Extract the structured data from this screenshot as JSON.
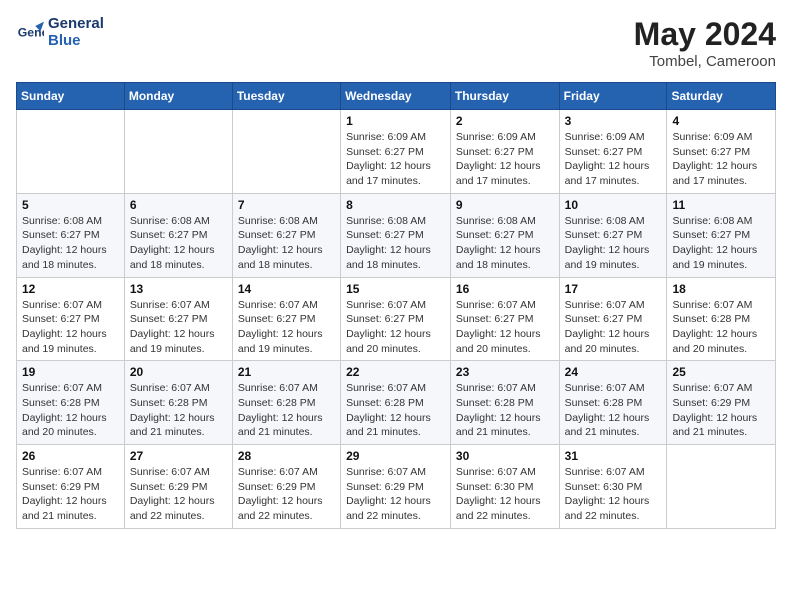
{
  "header": {
    "logo_line1": "General",
    "logo_line2": "Blue",
    "month_year": "May 2024",
    "location": "Tombel, Cameroon"
  },
  "weekdays": [
    "Sunday",
    "Monday",
    "Tuesday",
    "Wednesday",
    "Thursday",
    "Friday",
    "Saturday"
  ],
  "weeks": [
    [
      {
        "day": "",
        "info": ""
      },
      {
        "day": "",
        "info": ""
      },
      {
        "day": "",
        "info": ""
      },
      {
        "day": "1",
        "info": "Sunrise: 6:09 AM\nSunset: 6:27 PM\nDaylight: 12 hours\nand 17 minutes."
      },
      {
        "day": "2",
        "info": "Sunrise: 6:09 AM\nSunset: 6:27 PM\nDaylight: 12 hours\nand 17 minutes."
      },
      {
        "day": "3",
        "info": "Sunrise: 6:09 AM\nSunset: 6:27 PM\nDaylight: 12 hours\nand 17 minutes."
      },
      {
        "day": "4",
        "info": "Sunrise: 6:09 AM\nSunset: 6:27 PM\nDaylight: 12 hours\nand 17 minutes."
      }
    ],
    [
      {
        "day": "5",
        "info": "Sunrise: 6:08 AM\nSunset: 6:27 PM\nDaylight: 12 hours\nand 18 minutes."
      },
      {
        "day": "6",
        "info": "Sunrise: 6:08 AM\nSunset: 6:27 PM\nDaylight: 12 hours\nand 18 minutes."
      },
      {
        "day": "7",
        "info": "Sunrise: 6:08 AM\nSunset: 6:27 PM\nDaylight: 12 hours\nand 18 minutes."
      },
      {
        "day": "8",
        "info": "Sunrise: 6:08 AM\nSunset: 6:27 PM\nDaylight: 12 hours\nand 18 minutes."
      },
      {
        "day": "9",
        "info": "Sunrise: 6:08 AM\nSunset: 6:27 PM\nDaylight: 12 hours\nand 18 minutes."
      },
      {
        "day": "10",
        "info": "Sunrise: 6:08 AM\nSunset: 6:27 PM\nDaylight: 12 hours\nand 19 minutes."
      },
      {
        "day": "11",
        "info": "Sunrise: 6:08 AM\nSunset: 6:27 PM\nDaylight: 12 hours\nand 19 minutes."
      }
    ],
    [
      {
        "day": "12",
        "info": "Sunrise: 6:07 AM\nSunset: 6:27 PM\nDaylight: 12 hours\nand 19 minutes."
      },
      {
        "day": "13",
        "info": "Sunrise: 6:07 AM\nSunset: 6:27 PM\nDaylight: 12 hours\nand 19 minutes."
      },
      {
        "day": "14",
        "info": "Sunrise: 6:07 AM\nSunset: 6:27 PM\nDaylight: 12 hours\nand 19 minutes."
      },
      {
        "day": "15",
        "info": "Sunrise: 6:07 AM\nSunset: 6:27 PM\nDaylight: 12 hours\nand 20 minutes."
      },
      {
        "day": "16",
        "info": "Sunrise: 6:07 AM\nSunset: 6:27 PM\nDaylight: 12 hours\nand 20 minutes."
      },
      {
        "day": "17",
        "info": "Sunrise: 6:07 AM\nSunset: 6:27 PM\nDaylight: 12 hours\nand 20 minutes."
      },
      {
        "day": "18",
        "info": "Sunrise: 6:07 AM\nSunset: 6:28 PM\nDaylight: 12 hours\nand 20 minutes."
      }
    ],
    [
      {
        "day": "19",
        "info": "Sunrise: 6:07 AM\nSunset: 6:28 PM\nDaylight: 12 hours\nand 20 minutes."
      },
      {
        "day": "20",
        "info": "Sunrise: 6:07 AM\nSunset: 6:28 PM\nDaylight: 12 hours\nand 21 minutes."
      },
      {
        "day": "21",
        "info": "Sunrise: 6:07 AM\nSunset: 6:28 PM\nDaylight: 12 hours\nand 21 minutes."
      },
      {
        "day": "22",
        "info": "Sunrise: 6:07 AM\nSunset: 6:28 PM\nDaylight: 12 hours\nand 21 minutes."
      },
      {
        "day": "23",
        "info": "Sunrise: 6:07 AM\nSunset: 6:28 PM\nDaylight: 12 hours\nand 21 minutes."
      },
      {
        "day": "24",
        "info": "Sunrise: 6:07 AM\nSunset: 6:28 PM\nDaylight: 12 hours\nand 21 minutes."
      },
      {
        "day": "25",
        "info": "Sunrise: 6:07 AM\nSunset: 6:29 PM\nDaylight: 12 hours\nand 21 minutes."
      }
    ],
    [
      {
        "day": "26",
        "info": "Sunrise: 6:07 AM\nSunset: 6:29 PM\nDaylight: 12 hours\nand 21 minutes."
      },
      {
        "day": "27",
        "info": "Sunrise: 6:07 AM\nSunset: 6:29 PM\nDaylight: 12 hours\nand 22 minutes."
      },
      {
        "day": "28",
        "info": "Sunrise: 6:07 AM\nSunset: 6:29 PM\nDaylight: 12 hours\nand 22 minutes."
      },
      {
        "day": "29",
        "info": "Sunrise: 6:07 AM\nSunset: 6:29 PM\nDaylight: 12 hours\nand 22 minutes."
      },
      {
        "day": "30",
        "info": "Sunrise: 6:07 AM\nSunset: 6:30 PM\nDaylight: 12 hours\nand 22 minutes."
      },
      {
        "day": "31",
        "info": "Sunrise: 6:07 AM\nSunset: 6:30 PM\nDaylight: 12 hours\nand 22 minutes."
      },
      {
        "day": "",
        "info": ""
      }
    ]
  ]
}
